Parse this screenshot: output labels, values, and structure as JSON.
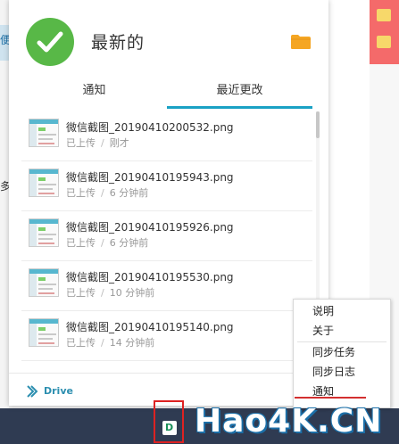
{
  "panel": {
    "title": "最新的",
    "icons": {
      "status": "check-icon",
      "folder": "folder-icon"
    },
    "colors": {
      "accent": "#1aa1c4",
      "success": "#58b847",
      "folder": "#f5a623"
    }
  },
  "tabs": [
    {
      "label": "通知",
      "active": false
    },
    {
      "label": "最近更改",
      "active": true
    }
  ],
  "files": [
    {
      "name": "微信截图_20190410200532.png",
      "status": "已上传",
      "time": "刚才"
    },
    {
      "name": "微信截图_20190410195943.png",
      "status": "已上传",
      "time": "6 分钟前"
    },
    {
      "name": "微信截图_20190410195926.png",
      "status": "已上传",
      "time": "6 分钟前"
    },
    {
      "name": "微信截图_20190410195530.png",
      "status": "已上传",
      "time": "10 分钟前"
    },
    {
      "name": "微信截图_20190410195140.png",
      "status": "已上传",
      "time": "14 分钟前"
    }
  ],
  "footer": {
    "drive_label": "Drive",
    "icon": "drive-icon"
  },
  "context_menu": {
    "items": [
      {
        "label": "说明"
      },
      {
        "label": "关于"
      },
      {
        "label": "同步任务"
      },
      {
        "label": "同步日志"
      },
      {
        "label": "通知"
      }
    ]
  },
  "tray": {
    "icon": "synology-drive-tray-icon",
    "glyph": "D"
  },
  "background": {
    "left_text_1": "便",
    "left_text_2": "多"
  },
  "watermark": {
    "text": "Hao4K.CN"
  }
}
